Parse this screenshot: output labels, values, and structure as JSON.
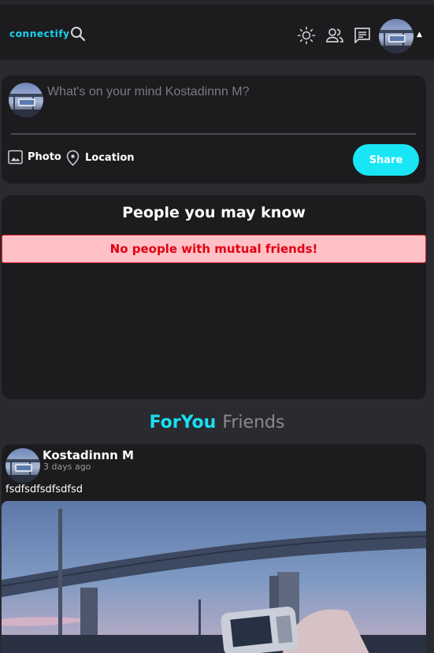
{
  "navbar": {
    "brand": "connectify",
    "icons": [
      "search-icon",
      "sun-icon",
      "people-icon",
      "chat-icon",
      "caret-up-icon"
    ],
    "caret": "▲"
  },
  "composer": {
    "placeholder": "What's on your mind Kostadinnn M?",
    "photo_label": "Photo",
    "location_label": "Location",
    "share_label": "Share"
  },
  "suggestions": {
    "title": "People you may know",
    "empty_message": "No people with mutual friends!"
  },
  "feed_tabs": {
    "active": "ForYou",
    "other": "Friends"
  },
  "post": {
    "author": "Kostadinnn M",
    "time": "3 days ago",
    "text": "fsdfsdfsdfsdfsd"
  },
  "colors": {
    "accent": "#19e0f2",
    "card_bg": "#1c1c1e",
    "page_bg": "#2a2b30",
    "alert_bg": "#ffc0c6",
    "alert_text": "#e00010"
  }
}
